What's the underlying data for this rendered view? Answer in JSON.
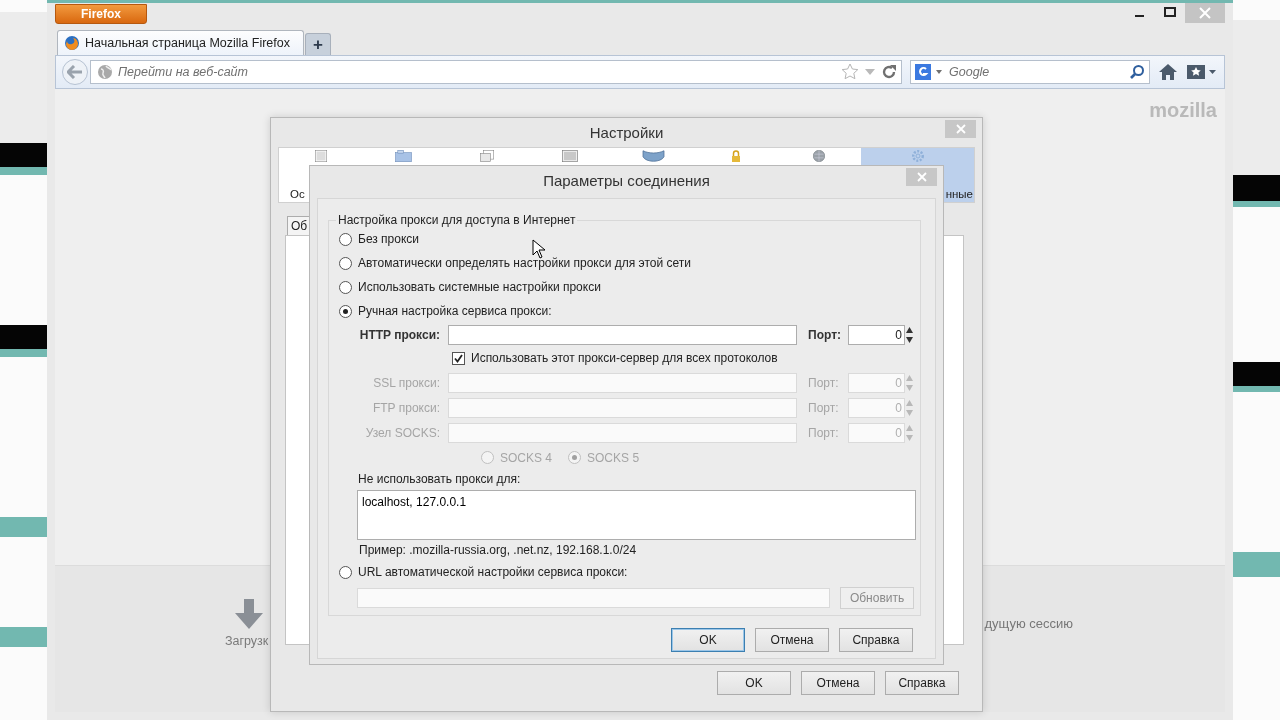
{
  "browser": {
    "menu_button": "Firefox",
    "tabs": [
      {
        "title": "Начальная страница Mozilla Firefox",
        "selected": true
      }
    ],
    "new_tab": "+",
    "url_placeholder": "Перейти на веб-сайт",
    "search_placeholder": "Google",
    "brand": "mozilla",
    "home_items": [
      {
        "label": "Загрузк"
      }
    ],
    "restore_label": "дущую сессию"
  },
  "settings": {
    "title": "Настройки",
    "panes": [
      {
        "kind": "window",
        "label": "Ос",
        "selected": false
      },
      {
        "kind": "tabs",
        "selected": false
      },
      {
        "kind": "pages",
        "selected": false
      },
      {
        "kind": "monitor",
        "selected": false
      },
      {
        "kind": "mask",
        "selected": false
      },
      {
        "kind": "lock",
        "selected": false
      },
      {
        "kind": "globe",
        "selected": false
      },
      {
        "kind": "gear",
        "label": "нные",
        "selected": true
      }
    ],
    "subtab": "Об",
    "buttons": [
      {
        "label": "OK",
        "default": false
      },
      {
        "label": "Отмена",
        "default": false
      },
      {
        "label": "Справка",
        "default": false
      }
    ]
  },
  "connection": {
    "title": "Параметры соединения",
    "group_label": "Настройка прокси для доступа в Интернет",
    "modes": [
      {
        "label": "Без прокси",
        "selected": false
      },
      {
        "label": "Автоматически определять настройки прокси для этой сети",
        "selected": false
      },
      {
        "label": "Использовать системные настройки прокси",
        "selected": false
      },
      {
        "label": "Ручная настройка сервиса прокси:",
        "selected": true
      }
    ],
    "http": {
      "label": "HTTP прокси:",
      "port_label": "Порт:",
      "port": "0",
      "disabled": false
    },
    "share_all": {
      "label": "Использовать этот прокси-сервер для всех протоколов",
      "checked": true
    },
    "proxies": [
      {
        "label": "SSL прокси:",
        "port_label": "Порт:",
        "port": "0",
        "disabled": true
      },
      {
        "label": "FTP прокси:",
        "port_label": "Порт:",
        "port": "0",
        "disabled": true
      },
      {
        "label": "Узел SOCKS:",
        "port_label": "Порт:",
        "port": "0",
        "disabled": true
      }
    ],
    "socks_versions": [
      {
        "label": "SOCKS 4",
        "selected": false,
        "disabled": true
      },
      {
        "label": "SOCKS 5",
        "selected": true,
        "disabled": true
      }
    ],
    "no_proxy_label": "Не использовать прокси для:",
    "no_proxy_value": "localhost, 127.0.0.1",
    "example": "Пример: .mozilla-russia.org, .net.nz, 192.168.1.0/24",
    "auto_url": {
      "label": "URL автоматической настройки сервиса прокси:",
      "selected": false,
      "reload": "Обновить",
      "disabled": true
    },
    "buttons": [
      {
        "label": "OK",
        "default": true
      },
      {
        "label": "Отмена",
        "default": false
      },
      {
        "label": "Справка",
        "default": false
      }
    ]
  }
}
